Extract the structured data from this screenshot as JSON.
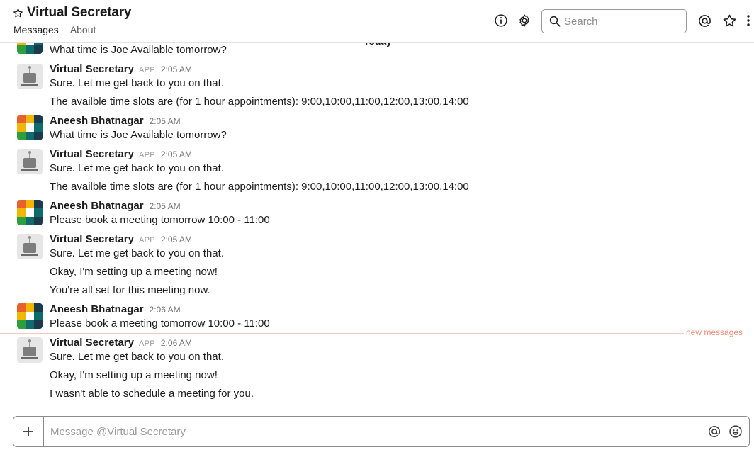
{
  "header": {
    "title": "Virtual Secretary",
    "tabs": [
      {
        "label": "Messages",
        "active": true
      },
      {
        "label": "About",
        "active": false
      }
    ],
    "search_placeholder": "Search"
  },
  "divider": {
    "label": "Today"
  },
  "new_messages_label": "new messages",
  "messages": [
    {
      "sender": "",
      "app": false,
      "time": "",
      "lines": [
        "What time is Joe Available tomorrow?"
      ]
    },
    {
      "sender": "Virtual Secretary",
      "app": true,
      "app_label": "APP",
      "time": "2:05 AM",
      "lines": [
        "Sure. Let me get back to you on that.",
        "The availble time slots are (for 1 hour appointments): 9:00,10:00,11:00,12:00,13:00,14:00"
      ]
    },
    {
      "sender": "Aneesh Bhatnagar",
      "app": false,
      "time": "2:05 AM",
      "lines": [
        "What time is Joe Available tomorrow?"
      ]
    },
    {
      "sender": "Virtual Secretary",
      "app": true,
      "app_label": "APP",
      "time": "2:05 AM",
      "lines": [
        "Sure. Let me get back to you on that.",
        "The availble time slots are (for 1 hour appointments): 9:00,10:00,11:00,12:00,13:00,14:00"
      ]
    },
    {
      "sender": "Aneesh Bhatnagar",
      "app": false,
      "time": "2:05 AM",
      "lines": [
        "Please book a meeting tomorrow 10:00 - 11:00"
      ]
    },
    {
      "sender": "Virtual Secretary",
      "app": true,
      "app_label": "APP",
      "time": "2:05 AM",
      "lines": [
        "Sure. Let me get back to you on that.",
        "Okay, I'm setting up a meeting now!",
        "You're all set for this meeting now."
      ]
    },
    {
      "sender": "Aneesh Bhatnagar",
      "app": false,
      "time": "2:06 AM",
      "lines": [
        "Please book a meeting tomorrow 10:00 - 11:00"
      ]
    },
    {
      "sender": "Virtual Secretary",
      "app": true,
      "app_label": "APP",
      "time": "2:06 AM",
      "lines": [
        "Sure. Let me get back to you on that.",
        "Okay, I'm setting up a meeting now!",
        "I wasn't able to schedule a meeting for you."
      ]
    }
  ],
  "composer": {
    "placeholder": "Message @Virtual Secretary"
  },
  "icons": {
    "title_star": "star-outline-icon",
    "info": "info-icon",
    "settings": "gear-icon",
    "search": "search-icon",
    "mentions": "at-icon",
    "starred": "star-outline-icon",
    "more": "more-vertical-icon",
    "attach": "plus-icon",
    "mention": "at-icon",
    "emoji": "emoji-icon"
  },
  "colors": {
    "new_messages": "#f08e78",
    "avatar_orange": "#e8612c",
    "avatar_yellow": "#f2b705",
    "avatar_teal": "#0e6d6b",
    "avatar_green": "#2f9e3f",
    "avatar_navy": "#1b3a4b"
  }
}
